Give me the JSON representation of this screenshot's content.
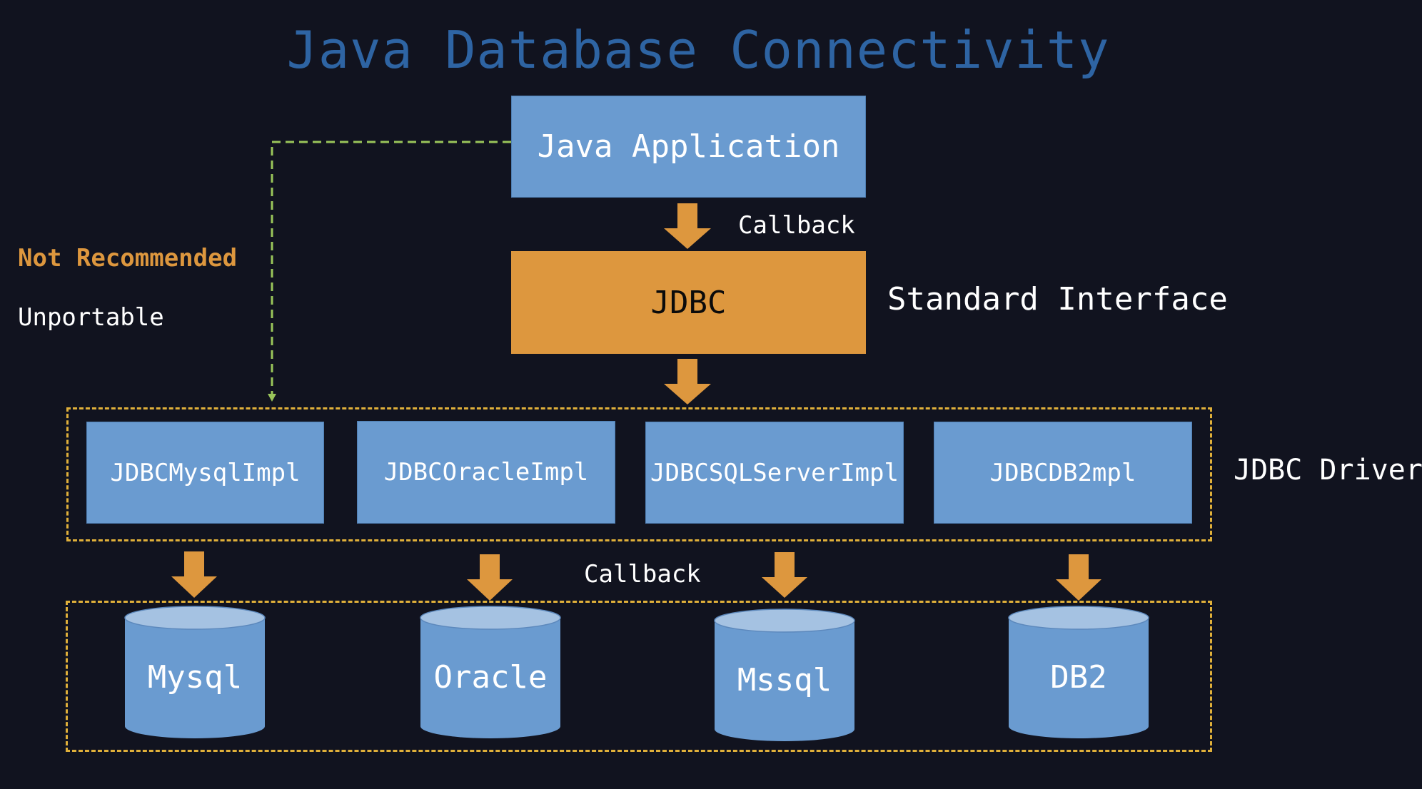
{
  "title": "Java Database Connectivity",
  "nodes": {
    "app": "Java Application",
    "jdbc": "JDBC",
    "drivers": [
      "JDBCMysqlImpl",
      "JDBCOracleImpl",
      "JDBCSQLServerImpl",
      "JDBCDB2mpl"
    ],
    "databases": [
      "Mysql",
      "Oracle",
      "Mssql",
      "DB2"
    ]
  },
  "labels": {
    "callback_top": "Callback",
    "callback_bottom": "Callback",
    "standard_interface": "Standard Interface",
    "jdbc_driver": "JDBC Driver",
    "not_recommended": "Not Recommended",
    "unportable": "Unportable"
  },
  "colors": {
    "background": "#11131f",
    "title": "#2e64a3",
    "box_blue": "#6a9bd0",
    "box_orange": "#dd973e",
    "arrow": "#dd973e",
    "dashed_group": "#e0b03a",
    "dashed_direct": "#9ac55a",
    "warning_text": "#dd973e"
  }
}
